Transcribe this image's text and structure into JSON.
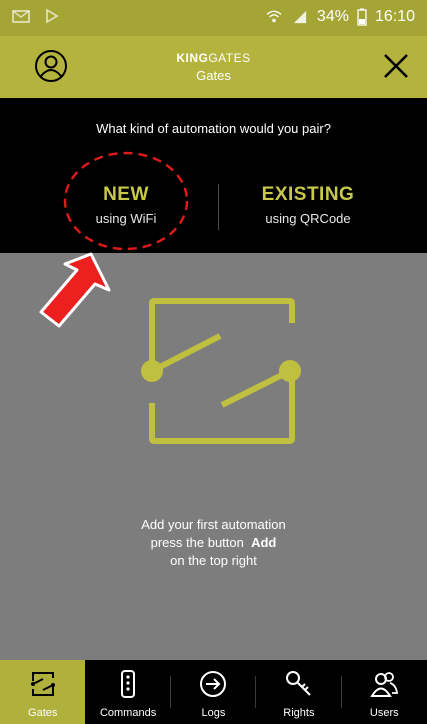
{
  "statusbar": {
    "battery": "34%",
    "time": "16:10"
  },
  "header": {
    "brand_bold": "KING",
    "brand_light": "GATES",
    "subtitle": "Gates"
  },
  "pair": {
    "question": "What kind of automation would you pair?",
    "new_title": "NEW",
    "new_sub": "using WiFi",
    "existing_title": "EXISTING",
    "existing_sub": "using QRCode"
  },
  "empty_message": {
    "line1": "Add your first automation",
    "line2_prefix": "press the button",
    "line2_bold": "Add",
    "line3": "on the top right"
  },
  "nav": [
    {
      "label": "Gates",
      "icon": "gate-icon",
      "active": true
    },
    {
      "label": "Commands",
      "icon": "remote-icon",
      "active": false
    },
    {
      "label": "Logs",
      "icon": "logs-icon",
      "active": false
    },
    {
      "label": "Rights",
      "icon": "key-icon",
      "active": false
    },
    {
      "label": "Users",
      "icon": "users-icon",
      "active": false
    }
  ],
  "colors": {
    "accent": "#b3b33e",
    "accent_text": "#c8c84a",
    "background": "#7d7d7d",
    "annotation": "#e11a1a"
  }
}
